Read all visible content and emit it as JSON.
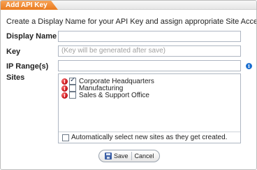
{
  "dialog": {
    "title": "Add API Key",
    "intro": "Create a Display Name for your API Key and assign appropriate Site Access"
  },
  "form": {
    "display_name_label": "Display Name",
    "display_name_value": "",
    "key_label": "Key",
    "key_placeholder": "(Key will be generated after save)",
    "ip_label": "IP Range(s)",
    "ip_value": "",
    "sites_label": "Sites"
  },
  "sites": [
    {
      "label": "Corporate Headquarters",
      "checked": true
    },
    {
      "label": "Manufacturing",
      "checked": false
    },
    {
      "label": "Sales & Support Office",
      "checked": false
    }
  ],
  "auto_select": {
    "label": "Automatically select new sites as they get created.",
    "checked": false
  },
  "buttons": {
    "save": "Save",
    "cancel": "Cancel"
  },
  "icons": {
    "info": "info-icon",
    "site_status": "red-alert-icon",
    "save": "floppy-disk-icon"
  },
  "colors": {
    "title_tab": "#ee8a33",
    "info_icon": "#1a6fd0",
    "site_status": "#c8141b"
  }
}
